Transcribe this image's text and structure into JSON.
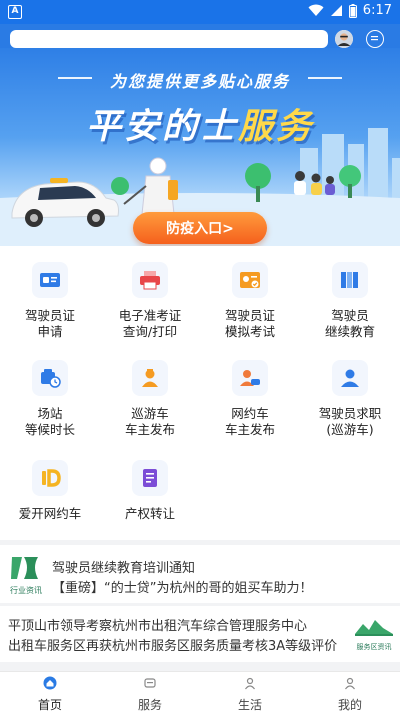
{
  "status_bar": {
    "time": "6:17",
    "app_indicator": "A"
  },
  "search": {
    "value": "",
    "placeholder": ""
  },
  "banner": {
    "slogan": "为您提供更多贴心服务",
    "title_main": "平安的士",
    "title_accent": "服务",
    "cta_label": "防疫入口>"
  },
  "services": [
    {
      "label": "驾驶员证\n申请",
      "icon": "driver-license-icon",
      "color": "#2f7be6"
    },
    {
      "label": "电子准考证\n查询/打印",
      "icon": "printer-icon",
      "color": "#e8464a"
    },
    {
      "label": "驾驶员证\n模拟考试",
      "icon": "exam-card-icon",
      "color": "#f59b22"
    },
    {
      "label": "驾驶员\n继续教育",
      "icon": "books-icon",
      "color": "#2f7be6"
    },
    {
      "label": "场站\n等候时长",
      "icon": "station-wait-icon",
      "color": "#2f7be6"
    },
    {
      "label": "巡游车\n车主发布",
      "icon": "taxi-driver-icon",
      "color": "#f59b22"
    },
    {
      "label": "网约车\n车主发布",
      "icon": "ride-hailing-driver-icon",
      "color": "#f07a3b"
    },
    {
      "label": "驾驶员求职\n(巡游车)",
      "icon": "job-seeker-icon",
      "color": "#2f7be6"
    },
    {
      "label": "爱开网约车",
      "icon": "ikai-logo-icon",
      "color": "#f5b422"
    },
    {
      "label": "产权转让",
      "icon": "title-transfer-icon",
      "color": "#7c4dd6"
    }
  ],
  "news": {
    "badge_label": "行业资讯",
    "item1": "驾驶员继续教育培训通知",
    "item2": "【重磅】“的士贷”为杭州的哥的姐买车助力！",
    "item3": "平顶山市领导考察杭州市出租汽车综合管理服务中心",
    "item4": "出租车服务区再获杭州市服务区服务质量考核3A等级评价",
    "side_logo_label": "服务区资讯"
  },
  "tabs": [
    {
      "label": "首页",
      "icon": "home-icon",
      "active": true
    },
    {
      "label": "服务",
      "icon": "service-icon",
      "active": false
    },
    {
      "label": "生活",
      "icon": "life-icon",
      "active": false
    },
    {
      "label": "我的",
      "icon": "profile-icon",
      "active": false
    }
  ],
  "colors": {
    "primary": "#2a7be4",
    "cta": "#f5601d",
    "accent": "#ffd94a"
  }
}
